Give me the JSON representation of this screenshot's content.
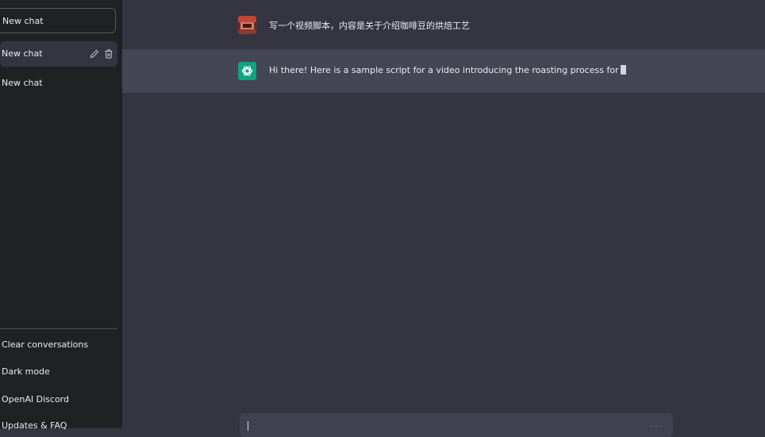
{
  "sidebar": {
    "new_chat_label": "New chat",
    "conversations": [
      {
        "label": "New chat"
      },
      {
        "label": "New chat"
      }
    ],
    "menu": [
      {
        "label": "Clear conversations"
      },
      {
        "label": "Dark mode"
      },
      {
        "label": "OpenAI Discord"
      },
      {
        "label": "Updates & FAQ"
      }
    ]
  },
  "chat": {
    "user_message": "写一个视频脚本，内容是关于介绍咖啡豆的烘焙工艺",
    "assistant_message": "Hi there! Here is a sample script for a video introducing the roasting process for"
  },
  "colors": {
    "sidebar_bg": "#202123",
    "main_bg": "#343541",
    "assistant_row_bg": "#444654",
    "openai_green": "#10a37f"
  }
}
